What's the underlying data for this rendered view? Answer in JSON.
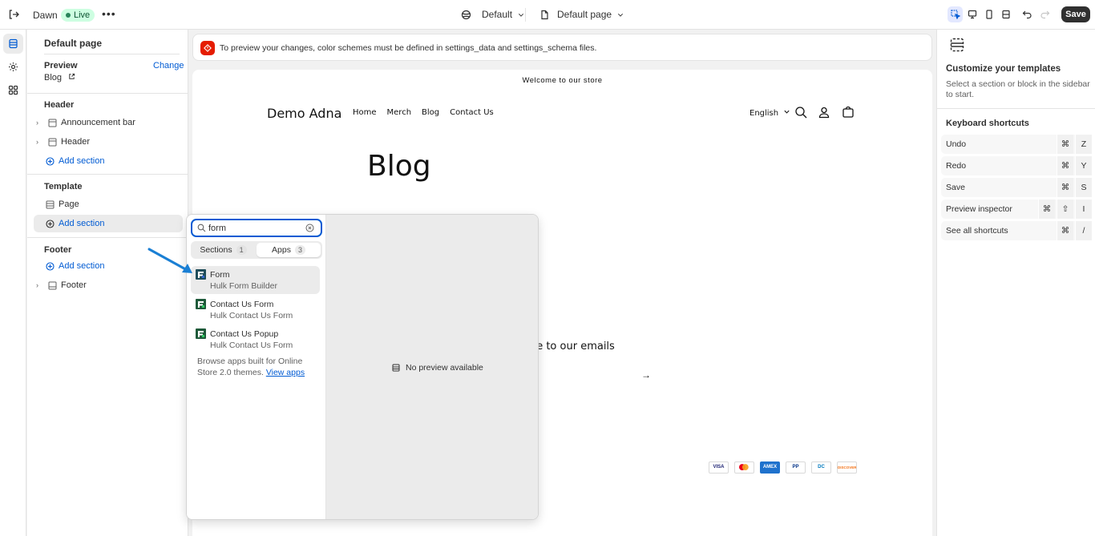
{
  "topbar": {
    "theme_name": "Dawn",
    "live_label": "Live",
    "more_label": "•••",
    "color_scheme_label": "Default",
    "template_label": "Default page",
    "save_label": "Save"
  },
  "sidebar": {
    "title": "Default page",
    "preview_heading": "Preview",
    "preview_change": "Change",
    "preview_value": "Blog",
    "header_heading": "Header",
    "header_items": [
      "Announcement bar",
      "Header"
    ],
    "header_add": "Add section",
    "template_heading": "Template",
    "template_items": [
      "Page"
    ],
    "template_add": "Add section",
    "footer_heading": "Footer",
    "footer_add": "Add section",
    "footer_items": [
      "Footer"
    ]
  },
  "banner": {
    "text": "To preview your changes, color schemes must be defined in settings_data and settings_schema files."
  },
  "store": {
    "welcome": "Welcome to our store",
    "logo": "Demo Adna",
    "nav": [
      "Home",
      "Merch",
      "Blog",
      "Contact Us"
    ],
    "language": "English",
    "page_title": "Blog",
    "subscribe": "ribe to our emails",
    "arrow": "→",
    "payments": [
      "VISA",
      "MC",
      "AMEX",
      "PP",
      "DC",
      "DISCOVER"
    ]
  },
  "picker": {
    "search_value": "form",
    "tab_sections": "Sections",
    "tab_sections_count": "1",
    "tab_apps": "Apps",
    "tab_apps_count": "3",
    "apps": [
      {
        "name": "Form",
        "developer": "Hulk Form Builder"
      },
      {
        "name": "Contact Us Form",
        "developer": "Hulk Contact Us Form"
      },
      {
        "name": "Contact Us Popup",
        "developer": "Hulk Contact Us Form"
      }
    ],
    "browse_text": "Browse apps built for Online Store 2.0 themes.",
    "browse_link": "View apps",
    "no_preview": "No preview available"
  },
  "right_panel": {
    "title": "Customize your templates",
    "description": "Select a section or block in the sidebar to start.",
    "shortcuts_title": "Keyboard shortcuts",
    "shortcuts": [
      {
        "label": "Undo",
        "keys": [
          "⌘",
          "Z"
        ]
      },
      {
        "label": "Redo",
        "keys": [
          "⌘",
          "Y"
        ]
      },
      {
        "label": "Save",
        "keys": [
          "⌘",
          "S"
        ]
      },
      {
        "label": "Preview inspector",
        "keys": [
          "⌘",
          "⇧",
          "I"
        ]
      },
      {
        "label": "See all shortcuts",
        "keys": [
          "⌘",
          "/"
        ]
      }
    ]
  },
  "colors": {
    "accent": "#005bd3",
    "live": "#29845a",
    "critical": "#e51c00",
    "annotation_arrow": "#1a7fd4"
  }
}
